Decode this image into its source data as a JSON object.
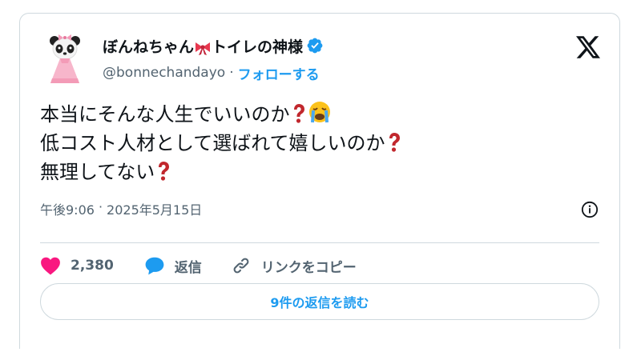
{
  "author": {
    "display_name_before": "ぼんねちゃん",
    "display_name_after": "トイレの神様",
    "handle": "@bonnechandayo",
    "separator": "·",
    "follow_label": "フォローする",
    "verified": true,
    "avatar_icon": "panda-girl-avatar",
    "name_emoji": "ribbon-emoji"
  },
  "tweet": {
    "lines": [
      "本当にそんな人生でいいのか",
      "低コスト人材として選ばれて嬉しいのか",
      "無理してない"
    ],
    "time": "午後9:06",
    "meta_separator": "·",
    "date": "2025年5月15日"
  },
  "actions": {
    "like_count": "2,380",
    "reply_label": "返信",
    "copy_link_label": "リンクをコピー"
  },
  "read_replies_label": "9件の返信を読む",
  "colors": {
    "accent": "#1d9bf0",
    "like": "#f91880",
    "question": "#c1272d",
    "text": "#0f1419",
    "muted": "#536471",
    "border": "#cfd9de"
  }
}
